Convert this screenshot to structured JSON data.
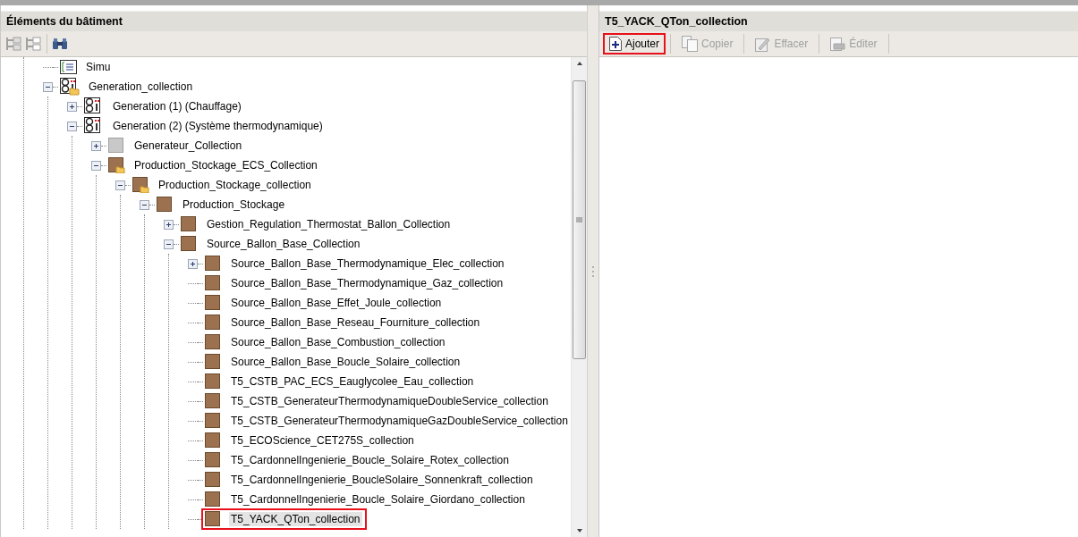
{
  "left_panel": {
    "title": "Éléments du bâtiment",
    "tree": [
      {
        "label": "Simu",
        "kind": "script",
        "selected": false
      },
      {
        "label": "Generation_collection",
        "kind": "generation-folder",
        "expanded": true,
        "selected": false,
        "children": [
          {
            "label": "Generation (1) (Chauffage)",
            "kind": "generation",
            "expanded": false,
            "selected": false
          },
          {
            "label": "Generation (2) (Système thermodynamique)",
            "kind": "generation",
            "expanded": true,
            "selected": false,
            "children": [
              {
                "label": "Generateur_Collection",
                "kind": "gray",
                "expanded": false,
                "selected": false
              },
              {
                "label": "Production_Stockage_ECS_Collection",
                "kind": "brown-folder",
                "expanded": true,
                "selected": false,
                "children": [
                  {
                    "label": "Production_Stockage_collection",
                    "kind": "brown-folder",
                    "expanded": true,
                    "selected": false,
                    "children": [
                      {
                        "label": "Production_Stockage",
                        "kind": "brown",
                        "expanded": true,
                        "selected": false,
                        "children": [
                          {
                            "label": "Gestion_Regulation_Thermostat_Ballon_Collection",
                            "kind": "brown",
                            "expanded": false,
                            "selected": false
                          },
                          {
                            "label": "Source_Ballon_Base_Collection",
                            "kind": "brown",
                            "expanded": true,
                            "selected": false,
                            "children": [
                              {
                                "label": "Source_Ballon_Base_Thermodynamique_Elec_collection",
                                "kind": "brown",
                                "expanded": false,
                                "selected": false
                              },
                              {
                                "label": "Source_Ballon_Base_Thermodynamique_Gaz_collection",
                                "kind": "brown",
                                "selected": false
                              },
                              {
                                "label": "Source_Ballon_Base_Effet_Joule_collection",
                                "kind": "brown",
                                "selected": false
                              },
                              {
                                "label": "Source_Ballon_Base_Reseau_Fourniture_collection",
                                "kind": "brown",
                                "selected": false
                              },
                              {
                                "label": "Source_Ballon_Base_Combustion_collection",
                                "kind": "brown",
                                "selected": false
                              },
                              {
                                "label": "Source_Ballon_Base_Boucle_Solaire_collection",
                                "kind": "brown",
                                "selected": false
                              },
                              {
                                "label": "T5_CSTB_PAC_ECS_Eauglycolee_Eau_collection",
                                "kind": "brown",
                                "selected": false
                              },
                              {
                                "label": "T5_CSTB_GenerateurThermodynamiqueDoubleService_collection",
                                "kind": "brown",
                                "selected": false
                              },
                              {
                                "label": "T5_CSTB_GenerateurThermodynamiqueGazDoubleService_collection",
                                "kind": "brown",
                                "selected": false
                              },
                              {
                                "label": "T5_ECOScience_CET275S_collection",
                                "kind": "brown",
                                "selected": false
                              },
                              {
                                "label": "T5_CardonnelIngenierie_Boucle_Solaire_Rotex_collection",
                                "kind": "brown",
                                "selected": false
                              },
                              {
                                "label": "T5_CardonnelIngenierie_BoucleSolaire_Sonnenkraft_collection",
                                "kind": "brown",
                                "selected": false
                              },
                              {
                                "label": "T5_CardonnelIngenierie_Boucle_Solaire_Giordano_collection",
                                "kind": "brown",
                                "selected": false
                              },
                              {
                                "label": "T5_YACK_QTon_collection",
                                "kind": "brown",
                                "selected": true,
                                "highlighted": true
                              }
                            ]
                          }
                        ]
                      }
                    ]
                  }
                ]
              }
            ]
          }
        ]
      }
    ]
  },
  "right_panel": {
    "title": "T5_YACK_QTon_collection",
    "buttons": [
      {
        "label": "Ajouter",
        "kind": "add",
        "disabled": false,
        "highlighted": true
      },
      {
        "label": "Copier",
        "kind": "copy",
        "disabled": true,
        "highlighted": false
      },
      {
        "label": "Effacer",
        "kind": "erase",
        "disabled": true,
        "highlighted": false
      },
      {
        "label": "Éditer",
        "kind": "edit",
        "disabled": true,
        "highlighted": false
      }
    ]
  }
}
